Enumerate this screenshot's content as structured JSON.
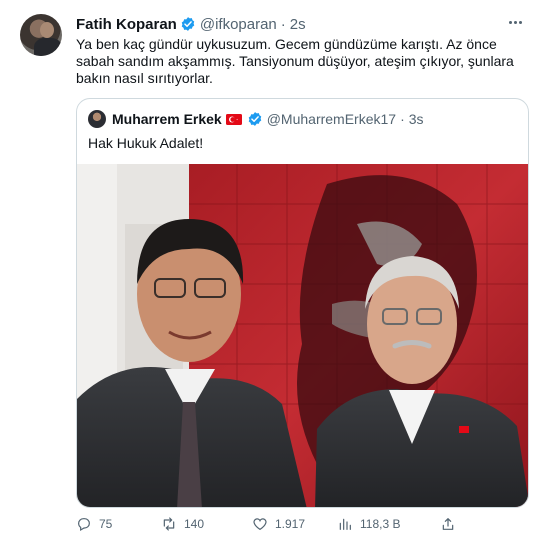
{
  "tweet": {
    "author_name": "Fatih Koparan",
    "author_handle": "@ifkoparan",
    "separator": "·",
    "time": "2s",
    "text": "Ya ben kaç gündür uykusuzum. Gecem gündüzüme karıştı. Az önce sabah sandım akşammış. Tansiyonum düşüyor, ateşim çıkıyor, şunlara bakın nasıl sırıtıyorlar.",
    "more_icon": "ellipsis-icon"
  },
  "quote": {
    "author_name": "Muharrem Erkek",
    "author_handle": "@MuharremErkek17",
    "separator": "·",
    "time": "3s",
    "text": "Hak Hukuk Adalet!",
    "flag_icon": "turkey-flag-icon"
  },
  "actions": {
    "replies": "75",
    "retweets": "140",
    "likes": "1.917",
    "views": "118,3 B"
  },
  "colors": {
    "verified": "#1d9bf0",
    "secondary_text": "#536471",
    "border": "#cfd9de",
    "wall_red": "#c0262e"
  }
}
